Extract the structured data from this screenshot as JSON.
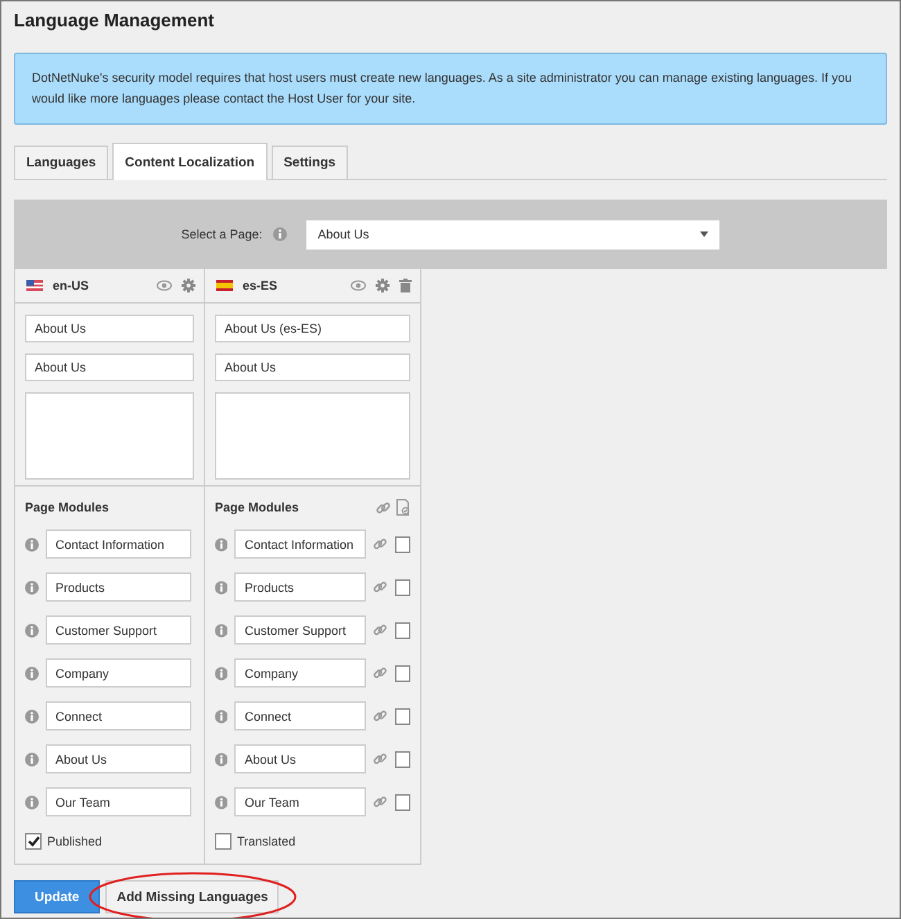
{
  "title": "Language Management",
  "notice": "DotNetNuke's security model requires that host users must create new languages. As a site administrator you can manage existing languages. If you would like more languages please contact the Host User for your site.",
  "tabs": [
    {
      "label": "Languages",
      "selected": false
    },
    {
      "label": "Content Localization",
      "selected": true
    },
    {
      "label": "Settings",
      "selected": false
    }
  ],
  "page_select": {
    "label": "Select a Page:",
    "value": "About Us"
  },
  "locales": [
    {
      "code": "en-US",
      "flag": {
        "kind": "us"
      },
      "kind": "source",
      "title": "About Us",
      "name": "About Us",
      "modules_heading": "Page Modules",
      "modules": [
        {
          "name": "Contact Information"
        },
        {
          "name": "Products"
        },
        {
          "name": "Customer Support"
        },
        {
          "name": "Company"
        },
        {
          "name": "Connect"
        },
        {
          "name": "About Us"
        },
        {
          "name": "Our Team"
        }
      ],
      "footer": {
        "label": "Published",
        "checked": true
      }
    },
    {
      "code": "es-ES",
      "flag": {
        "kind": "es"
      },
      "kind": "target",
      "title": "About Us (es-ES)",
      "name": "About Us",
      "modules_heading": "Page Modules",
      "modules": [
        {
          "name": "Contact Information",
          "checked": false
        },
        {
          "name": "Products",
          "checked": false
        },
        {
          "name": "Customer Support",
          "checked": false
        },
        {
          "name": "Company",
          "checked": false
        },
        {
          "name": "Connect",
          "checked": false
        },
        {
          "name": "About Us",
          "checked": false
        },
        {
          "name": "Our Team",
          "checked": false
        }
      ],
      "footer": {
        "label": "Translated",
        "checked": false
      }
    }
  ],
  "buttons": [
    {
      "label": "Update",
      "kind": "primary",
      "highlighted": false
    },
    {
      "label": "Add Missing Languages",
      "kind": "secondary",
      "highlighted": true
    }
  ]
}
